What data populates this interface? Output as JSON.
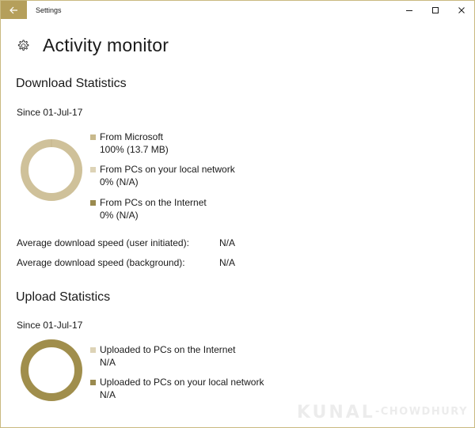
{
  "window": {
    "title": "Settings"
  },
  "page": {
    "title": "Activity monitor"
  },
  "download": {
    "section_title": "Download Statistics",
    "since": "Since 01-Jul-17",
    "legend": [
      {
        "label": "From Microsoft",
        "value": "100% (13.7 MB)",
        "color": "#c8b98c"
      },
      {
        "label": "From PCs on your local network",
        "value": "0% (N/A)",
        "color": "#ddd3b6"
      },
      {
        "label": "From PCs on the Internet",
        "value": "0% (N/A)",
        "color": "#9a8a4f"
      }
    ],
    "stats": [
      {
        "label": "Average download speed (user initiated):",
        "value": "N/A"
      },
      {
        "label": "Average download speed (background):",
        "value": "N/A"
      }
    ],
    "donut": {
      "share_microsoft": 100,
      "share_local": 0,
      "share_internet": 0,
      "ring_color": "#cfc19a"
    }
  },
  "upload": {
    "section_title": "Upload Statistics",
    "since": "Since 01-Jul-17",
    "legend": [
      {
        "label": "Uploaded to PCs on the Internet",
        "value": "N/A",
        "color": "#ddd3b6"
      },
      {
        "label": "Uploaded to PCs on your local network",
        "value": "N/A",
        "color": "#9a8a4f"
      }
    ],
    "donut": {
      "ring_color": "#a08e4c"
    }
  },
  "accent_color": "#b59f5b",
  "watermark": {
    "main": "KUNAL",
    "sub": "CHOWDHURY"
  }
}
